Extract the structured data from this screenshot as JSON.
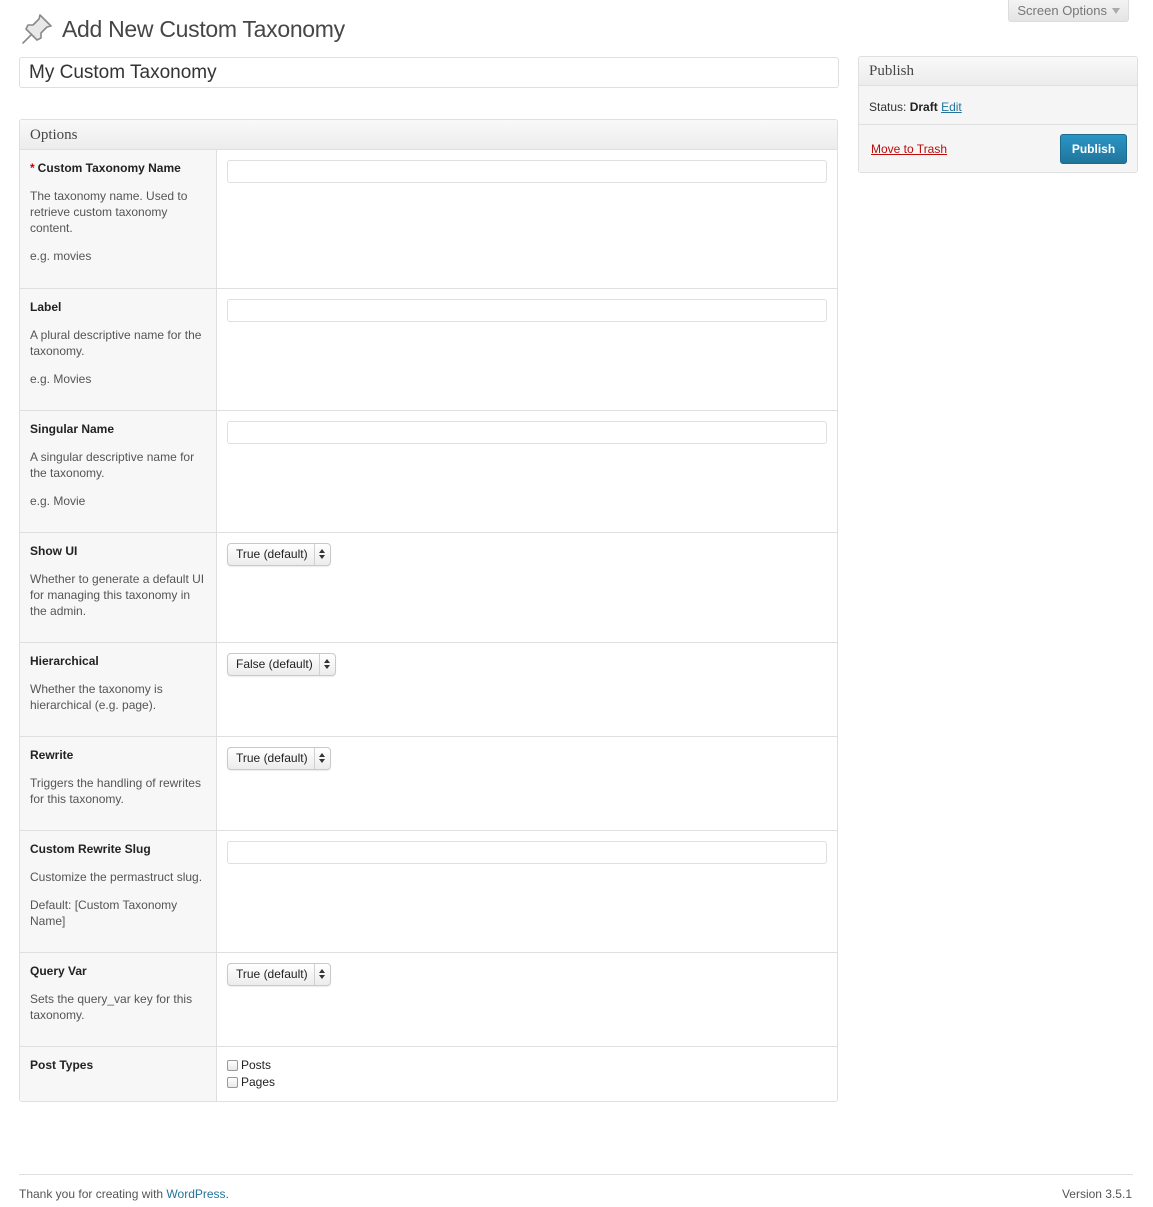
{
  "header": {
    "title": "Add New Custom Taxonomy",
    "screen_options": "Screen Options"
  },
  "title_field": {
    "value": "My Custom Taxonomy"
  },
  "options_box": {
    "heading": "Options",
    "rows": [
      {
        "label": "Custom Taxonomy Name",
        "required": "*",
        "desc": "The taxonomy name. Used to retrieve custom taxonomy content.",
        "example": "e.g. movies",
        "control": "text"
      },
      {
        "label": "Label",
        "desc": "A plural descriptive name for the taxonomy.",
        "example": "e.g. Movies",
        "control": "text"
      },
      {
        "label": "Singular Name",
        "desc": "A singular descriptive name for the taxonomy.",
        "example": "e.g. Movie",
        "control": "text"
      },
      {
        "label": "Show UI",
        "desc": "Whether to generate a default UI for managing this taxonomy in the admin.",
        "control": "select",
        "selected": "True (default)"
      },
      {
        "label": "Hierarchical",
        "desc": "Whether the taxonomy is hierarchical (e.g. page).",
        "control": "select",
        "selected": "False (default)"
      },
      {
        "label": "Rewrite",
        "desc": "Triggers the handling of rewrites for this taxonomy.",
        "control": "select",
        "selected": "True (default)"
      },
      {
        "label": "Custom Rewrite Slug",
        "desc": "Customize the permastruct slug.",
        "example": "Default: [Custom Taxonomy Name]",
        "control": "text"
      },
      {
        "label": "Query Var",
        "desc": "Sets the query_var key for this taxonomy.",
        "control": "select",
        "selected": "True (default)"
      },
      {
        "label": "Post Types",
        "control": "checkboxes",
        "options": [
          "Posts",
          "Pages"
        ]
      }
    ]
  },
  "publish_box": {
    "heading": "Publish",
    "status_label": "Status:",
    "status_value": "Draft",
    "edit_link": "Edit",
    "trash_link": "Move to Trash",
    "publish_button": "Publish"
  },
  "footer": {
    "thanks_prefix": "Thank you for creating with",
    "wordpress_link": "WordPress",
    "version": "Version 3.5.1"
  },
  "colors": {
    "link": "#21759b",
    "trash": "#bc0b0b",
    "publish_button": "#21759b",
    "required_marker": "#cc0000"
  },
  "icons": [
    "pushpin-icon",
    "chevron-down-icon",
    "select-arrows-icon"
  ]
}
